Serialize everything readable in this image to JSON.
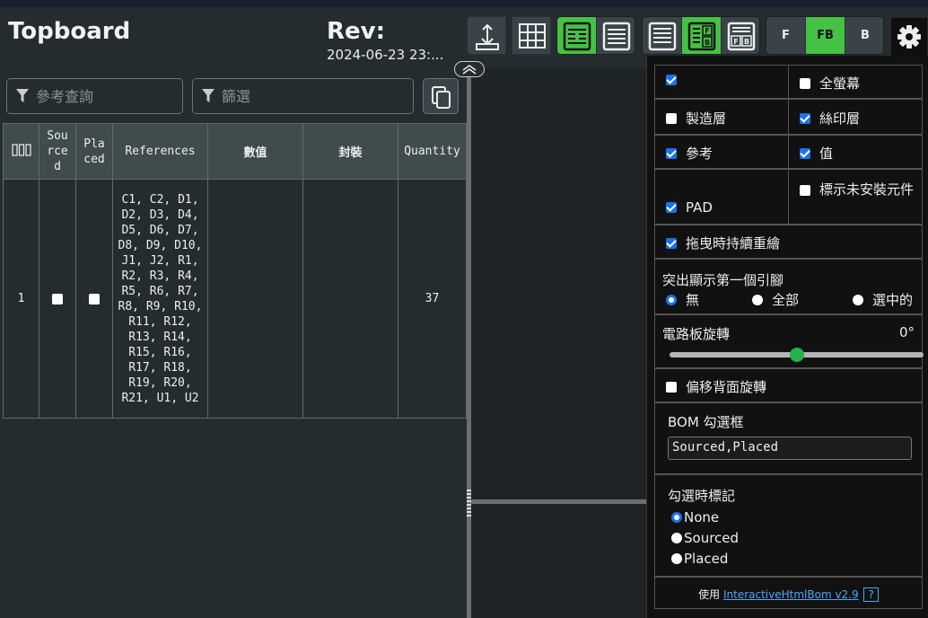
{
  "header": {
    "title": "Topboard",
    "rev_label": "Rev:",
    "rev_date": "2024-06-23 23:..."
  },
  "toolbar": {
    "fb_buttons": [
      {
        "label": "F",
        "active": false
      },
      {
        "label": "FB",
        "active": true
      },
      {
        "label": "B",
        "active": false
      }
    ],
    "colors": {
      "active": "#45c144",
      "inactive": "#3a4448"
    }
  },
  "filters": {
    "ref_placeholder": "參考查詢",
    "filter_placeholder": "篩選"
  },
  "bom": {
    "columns": [
      "Sourced",
      "Placed",
      "References",
      "數值",
      "封裝",
      "Quantity"
    ],
    "rows": [
      {
        "index": "1",
        "sourced": false,
        "placed": false,
        "references": "C1, C2, D1, D2, D3, D4, D5, D6, D7, D8, D9, D10, J1, J2, R1, R2, R3, R4, R5, R6, R7, R8, R9, R10, R11, R12, R13, R14, R15, R16, R17, R18, R19, R20, R21, U1, U2",
        "value": "",
        "footprint": "",
        "quantity": "37"
      }
    ]
  },
  "settings": {
    "darkmode_label": "",
    "darkmode": true,
    "fullscreen_label": "全螢幕",
    "fullscreen": false,
    "fab_label": "製造層",
    "fab": false,
    "silk_label": "絲印層",
    "silk": true,
    "refs_label": "參考",
    "refs": true,
    "values_label": "值",
    "values": true,
    "pads_label": "PAD",
    "pads": true,
    "dnp_label": "標示未安裝元件",
    "dnp": false,
    "redraw_label": "拖曳時持續重繪",
    "redraw": true,
    "highlight_pin1_label": "突出顯示第一個引腳",
    "highlight_options": [
      "無",
      "全部",
      "選中的"
    ],
    "highlight_selected": 0,
    "rotation_label": "電路板旋轉",
    "rotation_value": "0°",
    "rotation_fraction": 0.5,
    "offset_back_label": "偏移背面旋轉",
    "offset_back": false,
    "bom_checkboxes_label": "BOM 勾選框",
    "bom_checkboxes_value": "Sourced,Placed",
    "mark_when_checked_label": "勾選時標記",
    "mark_options": [
      "None",
      "Sourced",
      "Placed"
    ],
    "mark_selected": 0,
    "footer_prefix": "使用",
    "footer_link": "InteractiveHtmlBom v2.9",
    "footer_help": "?"
  }
}
